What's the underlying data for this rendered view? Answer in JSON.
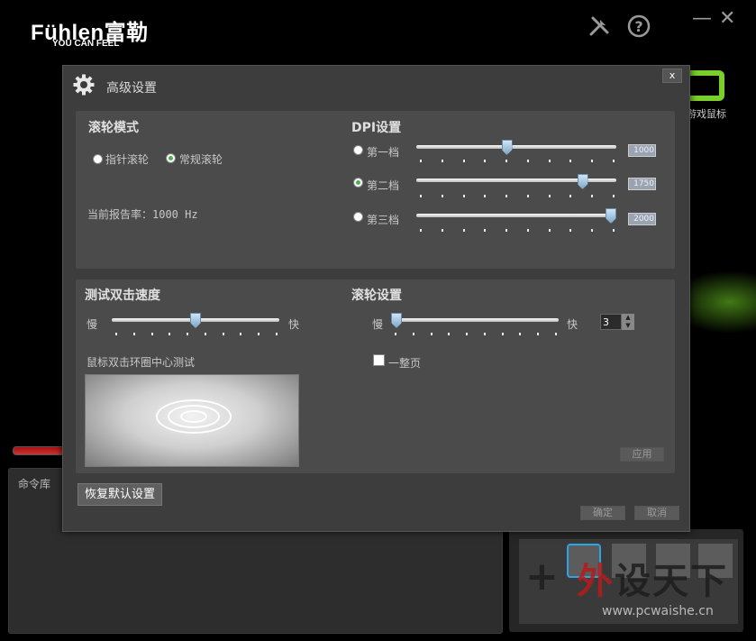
{
  "brand": {
    "name": "Fühlen富勒",
    "tagline": "YOU CAN FEEL"
  },
  "toolbar": {
    "tools_icon": "tools-icon",
    "help_icon": "help-icon",
    "minimize_label": "—",
    "close_label": "✕"
  },
  "background": {
    "product_label": "游戏鼠标",
    "command_library_label": "命令库",
    "add_symbol": "+"
  },
  "watermark": {
    "text_accent": "外",
    "text_main": "设天下",
    "url": "www.pcwaishe.cn"
  },
  "dialog": {
    "title": "高级设置",
    "close_label": "x",
    "scroll_mode": {
      "heading": "滚轮模式",
      "options": [
        {
          "label": "指针滚轮",
          "selected": false
        },
        {
          "label": "常规滚轮",
          "selected": true
        }
      ],
      "report_rate_text": "当前报告率：1000 Hz"
    },
    "dpi": {
      "heading": "DPI设置",
      "levels": [
        {
          "label": "第一档",
          "value": "1000",
          "selected": false,
          "level": 0.45
        },
        {
          "label": "第二档",
          "value": "1750",
          "selected": true,
          "level": 0.85
        },
        {
          "label": "第三档",
          "value": "2000",
          "selected": false,
          "level": 1.0
        }
      ]
    },
    "double_click": {
      "heading": "测试双击速度",
      "slow_label": "慢",
      "fast_label": "快",
      "level": 0.5,
      "test_label": "鼠标双击环圈中心测试"
    },
    "wheel": {
      "heading": "滚轮设置",
      "slow_label": "慢",
      "fast_label": "快",
      "level": 0.0,
      "value": "3",
      "full_page_label": "一整页",
      "full_page_checked": false,
      "apply_label": "应用"
    },
    "restore_label": "恢复默认设置",
    "ok_label": "确定",
    "cancel_label": "取消"
  },
  "colors": {
    "accent_green": "#7acf2a",
    "selected_slot": "#2aa5e6",
    "dialog_bg": "#3d3d3d",
    "panel_bg": "#4b4b4b"
  }
}
